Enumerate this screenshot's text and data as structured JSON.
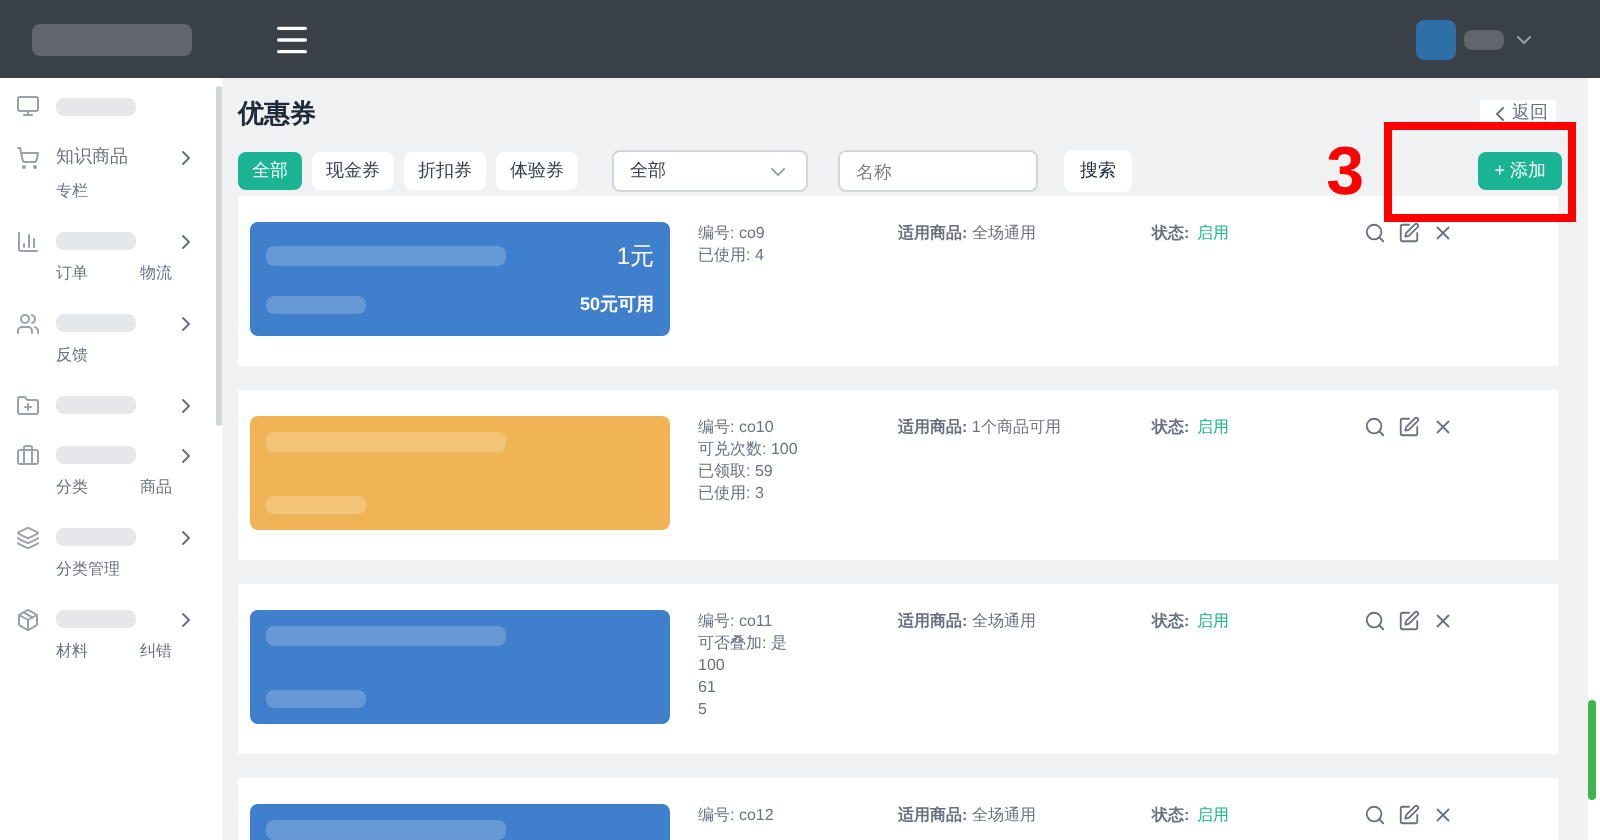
{
  "sidebar": {
    "groups": [
      {
        "expandable": false
      },
      {
        "expandable": true,
        "title": "知识商品",
        "subs": [
          "专栏"
        ]
      },
      {
        "expandable": true,
        "subs": [
          "订单",
          "物流"
        ]
      },
      {
        "expandable": true,
        "subs": [
          "反馈"
        ]
      },
      {
        "expandable": true
      },
      {
        "expandable": true,
        "subs": [
          "分类",
          "商品"
        ]
      },
      {
        "expandable": true,
        "subs": [
          "分类管理"
        ]
      },
      {
        "expandable": true,
        "subs": [
          "材料",
          "纠错"
        ]
      }
    ]
  },
  "page": {
    "title": "优惠券",
    "back": "返回"
  },
  "tabs": [
    {
      "label": "全部",
      "selected": true
    },
    {
      "label": "现金券",
      "selected": false
    },
    {
      "label": "折扣券",
      "selected": false
    },
    {
      "label": "体验券",
      "selected": false
    }
  ],
  "filter": {
    "value": "全部"
  },
  "search": {
    "placeholder": "名称",
    "button": "搜索"
  },
  "add_button": "+ 添加",
  "annotation": "3",
  "coupons": [
    {
      "color": "#3f7fcb",
      "amount": "1元",
      "condition": "50元可用",
      "details": [
        "编号: co9",
        "已使用: 4"
      ],
      "goods_label": "适用商品:",
      "goods": "全场通用",
      "status_label": "状态:",
      "status": "启用"
    },
    {
      "color": "#f0b457",
      "details": [
        "编号: co10",
        "可兑次数: 100",
        "已领取: 59",
        "已使用: 3"
      ],
      "goods_label": "适用商品:",
      "goods": "1个商品可用",
      "status_label": "状态:",
      "status": "启用"
    },
    {
      "color": "#3f7fcb",
      "details": [
        "编号: co11",
        "可否叠加: 是",
        "100",
        "61",
        "5"
      ],
      "goods_label": "适用商品:",
      "goods": "全场通用",
      "status_label": "状态:",
      "status": "启用"
    },
    {
      "color": "#3f7fcb",
      "details": [
        "编号: co12"
      ],
      "goods_label": "适用商品:",
      "goods": "全场通用",
      "status_label": "状态:",
      "status": "启用"
    }
  ]
}
